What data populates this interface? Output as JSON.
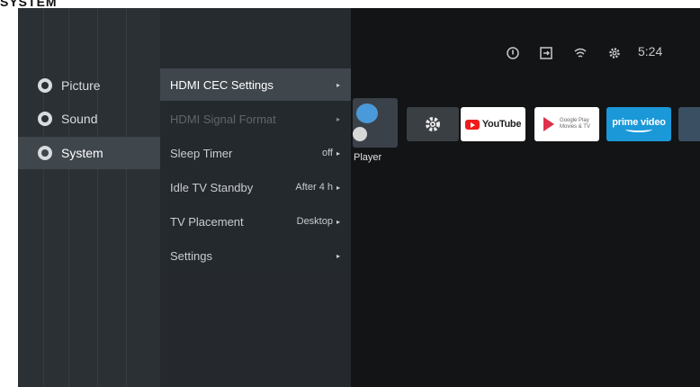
{
  "page_header": "SYSTEM",
  "status_bar": {
    "info_icon": "info-circle-icon",
    "input_icon": "input-source-icon",
    "wifi_icon": "wifi-icon",
    "settings_icon": "gear-icon",
    "time": "5:24"
  },
  "categories": [
    {
      "label": "Picture",
      "icon": "picture-icon"
    },
    {
      "label": "Sound",
      "icon": "sound-icon"
    },
    {
      "label": "System",
      "icon": "wrench-icon"
    }
  ],
  "submenu": [
    {
      "label": "HDMI CEC Settings",
      "value": ""
    },
    {
      "label": "HDMI Signal Format",
      "value": ""
    },
    {
      "label": "Sleep Timer",
      "value": "off"
    },
    {
      "label": "Idle TV Standby",
      "value": "After 4 h"
    },
    {
      "label": "TV Placement",
      "value": "Desktop"
    },
    {
      "label": "Settings",
      "value": ""
    }
  ],
  "arrow": "▸",
  "apps": {
    "player_label": "Player",
    "youtube_label": "YouTube",
    "gplay_line1": "Google Play",
    "gplay_line2": "Movies & TV",
    "prime_label": "prime video"
  },
  "colors": {
    "screen_bg": "#121416",
    "panel_left": "#2b3034",
    "panel_sub": "#24292d",
    "highlight": "#3f464c",
    "prime_blue": "#1a98d8",
    "youtube_red": "#ee1c1b"
  }
}
